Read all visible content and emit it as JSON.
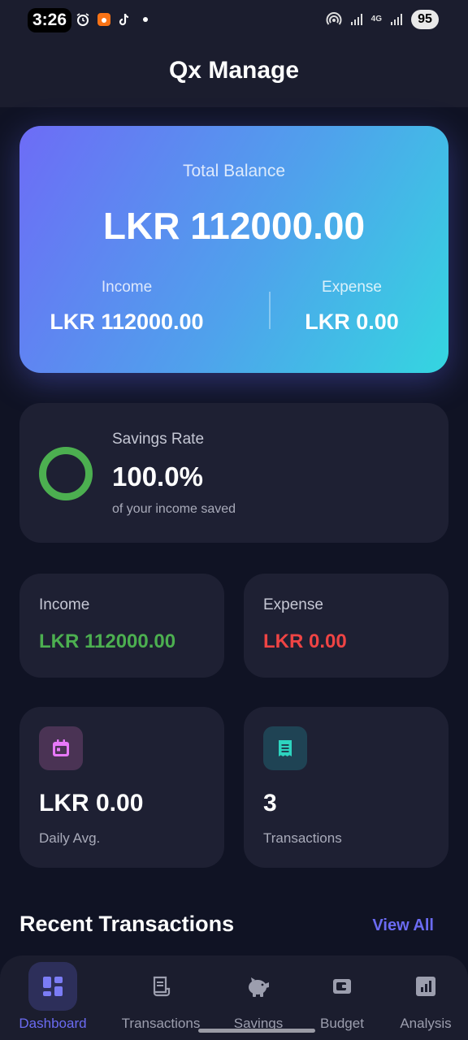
{
  "status_bar": {
    "time": "3:26",
    "network": "4G",
    "battery": "95",
    "icons_left": [
      "alarm-icon",
      "app-notification-icon",
      "tiktok-icon",
      "dot-icon"
    ],
    "icons_right": [
      "hotspot-icon",
      "signal-icon",
      "network-4g-icon",
      "signal-icon",
      "battery-icon"
    ]
  },
  "header": {
    "title": "Qx Manage"
  },
  "balance": {
    "label": "Total Balance",
    "amount": "LKR 112000.00",
    "income_label": "Income",
    "income_value": "LKR 112000.00",
    "expense_label": "Expense",
    "expense_value": "LKR 0.00"
  },
  "savings": {
    "label": "Savings Rate",
    "rate": "100.0%",
    "rate_fraction": 1.0,
    "subtitle": "of your income saved"
  },
  "summary": {
    "income_label": "Income",
    "income_value": "LKR 112000.00",
    "expense_label": "Expense",
    "expense_value": "LKR 0.00"
  },
  "stats": {
    "daily_avg_value": "LKR 0.00",
    "daily_avg_label": "Daily Avg.",
    "daily_avg_icon": "calendar-icon",
    "transactions_value": "3",
    "transactions_label": "Transactions",
    "transactions_icon": "receipt-icon"
  },
  "recent": {
    "title": "Recent Transactions",
    "view_all": "View All"
  },
  "nav": {
    "items": [
      {
        "label": "Dashboard",
        "icon": "dashboard-icon",
        "active": true
      },
      {
        "label": "Transactions",
        "icon": "receipt-icon",
        "active": false
      },
      {
        "label": "Savings",
        "icon": "piggy-bank-icon",
        "active": false
      },
      {
        "label": "Budget",
        "icon": "wallet-icon",
        "active": false
      },
      {
        "label": "Analysis",
        "icon": "bar-chart-icon",
        "active": false
      }
    ]
  },
  "colors": {
    "accent": "#6b6bf2",
    "income_green": "#4caf50",
    "expense_red": "#ef4444",
    "card_bg": "#1e2033",
    "background": "#101324"
  }
}
